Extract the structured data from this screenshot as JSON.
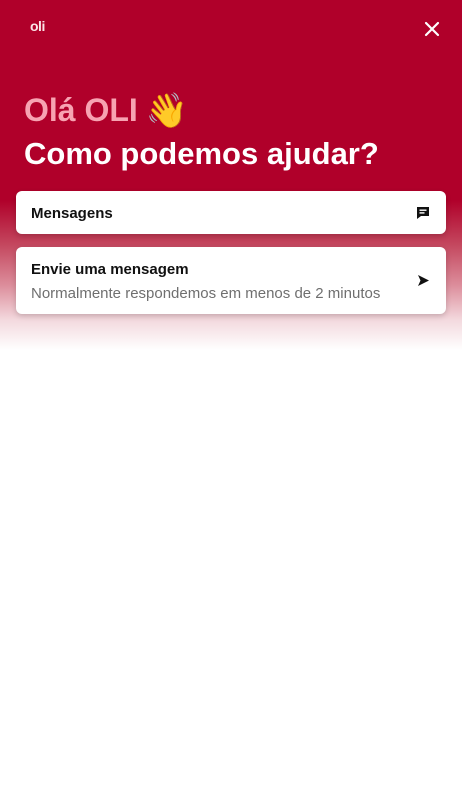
{
  "header": {
    "logo_text": "oli",
    "close_icon": "close-icon"
  },
  "hero": {
    "greeting": "Olá OLI",
    "wave_emoji": "👋",
    "headline": "Como podemos ajudar?"
  },
  "cards": {
    "messages": {
      "title": "Mensagens",
      "icon": "chat-bubble-icon"
    },
    "send": {
      "title": "Envie uma mensagem",
      "subtitle": "Normalmente respondemos em menos de 2 minutos",
      "icon": "send-arrow-icon"
    }
  },
  "colors": {
    "brand": "#b0002a",
    "greeting": "#f7a3b2",
    "headline": "#ffffff"
  }
}
